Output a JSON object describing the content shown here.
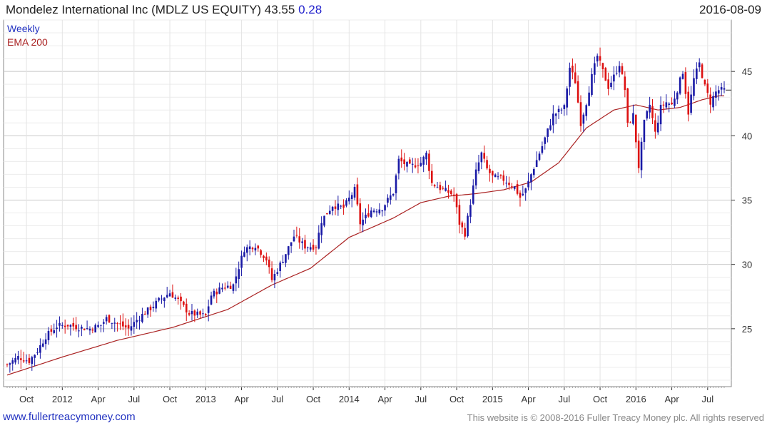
{
  "header": {
    "title": "Mondelez International Inc (MDLZ US EQUITY) 43.55",
    "change": "0.28",
    "date": "2016-08-09"
  },
  "footer": {
    "left": "www.fullertreacymoney.com",
    "right": "This website is © 2008-2016 Fuller Treacy Money plc. All rights reserved"
  },
  "colors": {
    "up": "#1a1aa6",
    "down": "#dd1111",
    "ema": "#aa2222",
    "grid": "#dcdcdc",
    "axis": "#333333"
  },
  "chart_data": {
    "type": "candlestick",
    "interval": "Weekly",
    "legend": [
      "Weekly",
      "EMA 200"
    ],
    "ylim": [
      20.5,
      49.0
    ],
    "yticks": [
      25,
      30,
      35,
      40,
      45
    ],
    "grid": true,
    "x_ticks": [
      {
        "label": "Oct",
        "week": 7
      },
      {
        "label": "2012",
        "week": 20
      },
      {
        "label": "Apr",
        "week": 33
      },
      {
        "label": "Jul",
        "week": 46
      },
      {
        "label": "Oct",
        "week": 59
      },
      {
        "label": "2013",
        "week": 72
      },
      {
        "label": "Apr",
        "week": 85
      },
      {
        "label": "Jul",
        "week": 98
      },
      {
        "label": "Oct",
        "week": 111
      },
      {
        "label": "2014",
        "week": 124
      },
      {
        "label": "Apr",
        "week": 137
      },
      {
        "label": "Jul",
        "week": 150
      },
      {
        "label": "Oct",
        "week": 163
      },
      {
        "label": "2015",
        "week": 176
      },
      {
        "label": "Apr",
        "week": 189
      },
      {
        "label": "Jul",
        "week": 202
      },
      {
        "label": "Oct",
        "week": 215
      },
      {
        "label": "2016",
        "week": 228
      },
      {
        "label": "Apr",
        "week": 241
      },
      {
        "label": "Jul",
        "week": 254
      }
    ],
    "n_weeks": 261,
    "close_anchors": [
      [
        0,
        22.2
      ],
      [
        4,
        22.8
      ],
      [
        8,
        22.5
      ],
      [
        11,
        23.3
      ],
      [
        14,
        24.4
      ],
      [
        18,
        25.2
      ],
      [
        22,
        25.3
      ],
      [
        26,
        25.1
      ],
      [
        30,
        25.0
      ],
      [
        34,
        25.3
      ],
      [
        36,
        25.8
      ],
      [
        40,
        25.4
      ],
      [
        44,
        25.0
      ],
      [
        48,
        25.9
      ],
      [
        52,
        26.6
      ],
      [
        55,
        27.2
      ],
      [
        59,
        27.8
      ],
      [
        62,
        27.2
      ],
      [
        66,
        26.2
      ],
      [
        72,
        26.0
      ],
      [
        74,
        27.6
      ],
      [
        78,
        28.2
      ],
      [
        82,
        28.4
      ],
      [
        86,
        31.2
      ],
      [
        90,
        31.5
      ],
      [
        94,
        30.4
      ],
      [
        96,
        28.8
      ],
      [
        100,
        30.4
      ],
      [
        104,
        32.2
      ],
      [
        108,
        31.4
      ],
      [
        112,
        31.4
      ],
      [
        114,
        33.4
      ],
      [
        118,
        34.6
      ],
      [
        122,
        34.4
      ],
      [
        126,
        35.8
      ],
      [
        128,
        33.2
      ],
      [
        132,
        34.2
      ],
      [
        136,
        34.4
      ],
      [
        140,
        35.6
      ],
      [
        142,
        38.1
      ],
      [
        146,
        37.6
      ],
      [
        150,
        37.9
      ],
      [
        152,
        38.6
      ],
      [
        154,
        36.3
      ],
      [
        158,
        35.8
      ],
      [
        162,
        35.4
      ],
      [
        164,
        33.2
      ],
      [
        166,
        32.4
      ],
      [
        168,
        34.8
      ],
      [
        170,
        37.2
      ],
      [
        172,
        38.6
      ],
      [
        174,
        37.4
      ],
      [
        176,
        36.8
      ],
      [
        180,
        36.6
      ],
      [
        184,
        36.0
      ],
      [
        186,
        35.2
      ],
      [
        188,
        35.8
      ],
      [
        190,
        37.0
      ],
      [
        194,
        39.2
      ],
      [
        198,
        41.6
      ],
      [
        202,
        42.2
      ],
      [
        204,
        45.3
      ],
      [
        206,
        44.2
      ],
      [
        208,
        41.0
      ],
      [
        210,
        42.6
      ],
      [
        212,
        44.6
      ],
      [
        214,
        46.2
      ],
      [
        216,
        45.0
      ],
      [
        218,
        43.8
      ],
      [
        220,
        44.6
      ],
      [
        222,
        45.6
      ],
      [
        224,
        43.6
      ],
      [
        225,
        40.8
      ],
      [
        227,
        41.6
      ],
      [
        229,
        37.6
      ],
      [
        231,
        41.0
      ],
      [
        233,
        42.4
      ],
      [
        235,
        40.2
      ],
      [
        237,
        42.2
      ],
      [
        239,
        42.6
      ],
      [
        241,
        42.4
      ],
      [
        243,
        43.6
      ],
      [
        245,
        45.0
      ],
      [
        246,
        43.4
      ],
      [
        247,
        41.8
      ],
      [
        249,
        44.4
      ],
      [
        251,
        45.6
      ],
      [
        253,
        43.8
      ],
      [
        255,
        42.6
      ],
      [
        257,
        43.4
      ],
      [
        258,
        43.55
      ]
    ],
    "ema_anchors": [
      [
        0,
        21.4
      ],
      [
        20,
        22.8
      ],
      [
        40,
        24.1
      ],
      [
        60,
        25.1
      ],
      [
        80,
        26.5
      ],
      [
        96,
        28.4
      ],
      [
        110,
        29.7
      ],
      [
        124,
        32.1
      ],
      [
        140,
        33.6
      ],
      [
        150,
        34.8
      ],
      [
        160,
        35.3
      ],
      [
        170,
        35.5
      ],
      [
        180,
        35.8
      ],
      [
        190,
        36.4
      ],
      [
        200,
        37.9
      ],
      [
        210,
        40.6
      ],
      [
        220,
        42.0
      ],
      [
        228,
        42.4
      ],
      [
        236,
        42.0
      ],
      [
        244,
        42.2
      ],
      [
        252,
        42.8
      ],
      [
        258,
        43.1
      ]
    ]
  }
}
